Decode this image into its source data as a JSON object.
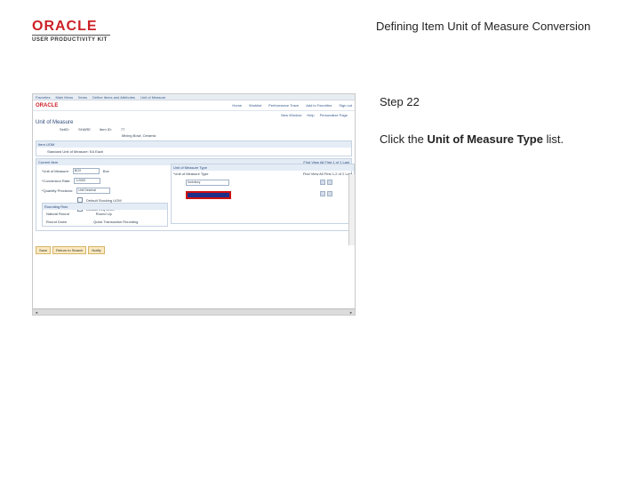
{
  "logo": {
    "word": "ORACLE",
    "sub": "USER PRODUCTIVITY KIT"
  },
  "doc_title": "Defining Item Unit of Measure Conversion",
  "step": "Step 22",
  "instruction": {
    "prefix": "Click the ",
    "emphasis": "Unit of Measure Type",
    "suffix": " list."
  },
  "screenshot": {
    "topbar": [
      "Favorites",
      "Main Menu",
      "Items",
      "Define Items and Attributes",
      "Unit of Measure"
    ],
    "brand": "ORACLE",
    "nav": [
      "Home",
      "Worklist",
      "Performance Trace",
      "Add to Favorites",
      "Sign out"
    ],
    "tools": [
      "New Window",
      "Help",
      "Personalize Page"
    ],
    "page_title": "Unit of Measure",
    "header_row": {
      "setid_label": "SetID:",
      "setid_value": "SHARE",
      "item_label": "Item ID:",
      "item_value": "77",
      "desc": "Mixing Bowl, Ceramic"
    },
    "item_section": {
      "title": "Item UOM",
      "label": "Standard Unit of Measure:",
      "value": "EA",
      "extra": "Each"
    },
    "main_section": {
      "title": "Current Item",
      "links": [
        "Find",
        "View All",
        "First",
        "1 of 1",
        "Last"
      ],
      "fields": {
        "uom_label": "*Unit of Measure:",
        "uom_value": "BOX",
        "uom_desc": "Box",
        "conv_label": "*Conversion Rate:",
        "conv_value": "1.0000",
        "qty_label": "*Quantity Precision:",
        "qty_value": "Unit Decimal",
        "check1": "Default Stocking UOM",
        "check2": "Default Req UOM"
      },
      "grid": {
        "title": "Unit of Measure Type",
        "links": [
          "Find",
          "View All",
          "First",
          "1-2 of 2",
          "Last"
        ],
        "subheader": "*Unit of Measure Type",
        "row1": "Inventory",
        "row2": ""
      },
      "rounding": {
        "title": "Rounding Rule",
        "option1": "Natural Round",
        "option2": "Round Up",
        "option3": "Round Down",
        "link": "Quick Transaction Rounding"
      }
    },
    "buttons": [
      "Save",
      "Return to Search",
      "Notify"
    ],
    "scroll_left": "◄",
    "scroll_right": "►"
  }
}
